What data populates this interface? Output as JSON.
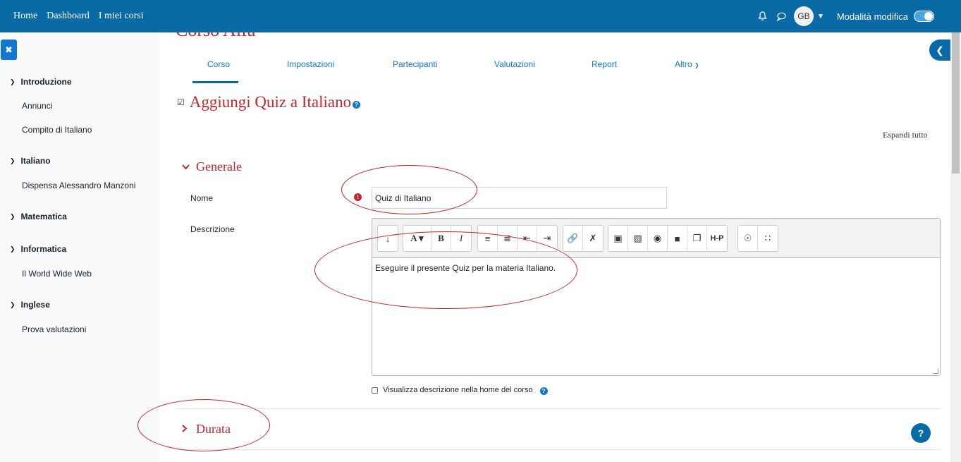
{
  "navbar": {
    "links": [
      "Home",
      "Dashboard",
      "I miei corsi"
    ],
    "avatar_initials": "GB",
    "edit_mode_label": "Modalità modifica",
    "edit_mode_on": true
  },
  "drawer": {
    "sections": [
      {
        "title": "Introduzione",
        "items": [
          "Annunci",
          "Compito di Italiano"
        ]
      },
      {
        "title": "Italiano",
        "items": [
          "Dispensa Alessandro Manzoni"
        ]
      },
      {
        "title": "Matematica",
        "items": []
      },
      {
        "title": "Informatica",
        "items": [
          "Il World Wide Web"
        ]
      },
      {
        "title": "Inglese",
        "items": [
          "Prova valutazioni"
        ]
      }
    ]
  },
  "course_title": "Corso Alfa",
  "tabs": [
    "Corso",
    "Impostazioni",
    "Partecipanti",
    "Valutazioni",
    "Report",
    "Altro"
  ],
  "active_tab": "Corso",
  "page_title": "Aggiungi Quiz a Italiano",
  "expand_all": "Espandi tutto",
  "form": {
    "general_title": "Generale",
    "name_label": "Nome",
    "name_value": "Quiz di Italiano",
    "description_label": "Descrizione",
    "description_value": "Eseguire il presente Quiz per la materia Italiano.",
    "show_description_label": "Visualizza descrizione nella home del corso",
    "show_description_checked": false,
    "duration_title": "Durata"
  },
  "colors": {
    "navbar": "#0a6aa6",
    "accent_red": "#c0282b",
    "link_blue": "#1177d1"
  }
}
